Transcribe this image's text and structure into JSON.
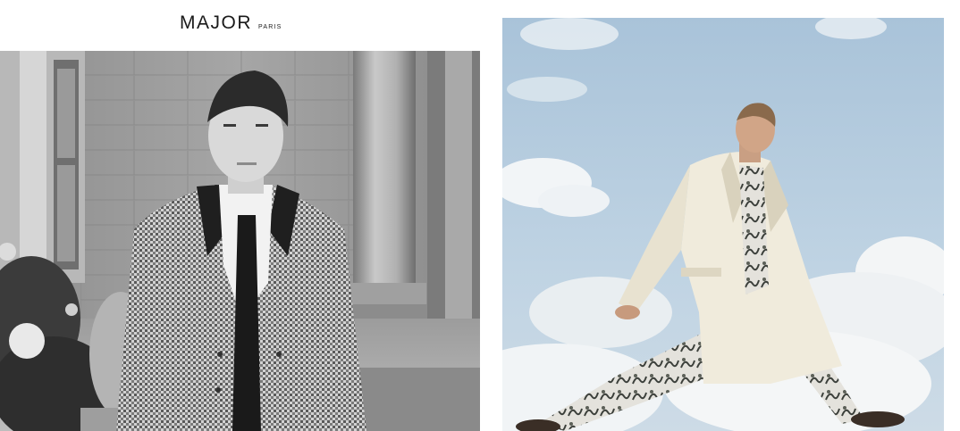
{
  "brand": {
    "name": "MAJOR",
    "location": "PARIS"
  },
  "photos": [
    {
      "tone": "black-and-white"
    },
    {
      "tone": "color"
    }
  ]
}
